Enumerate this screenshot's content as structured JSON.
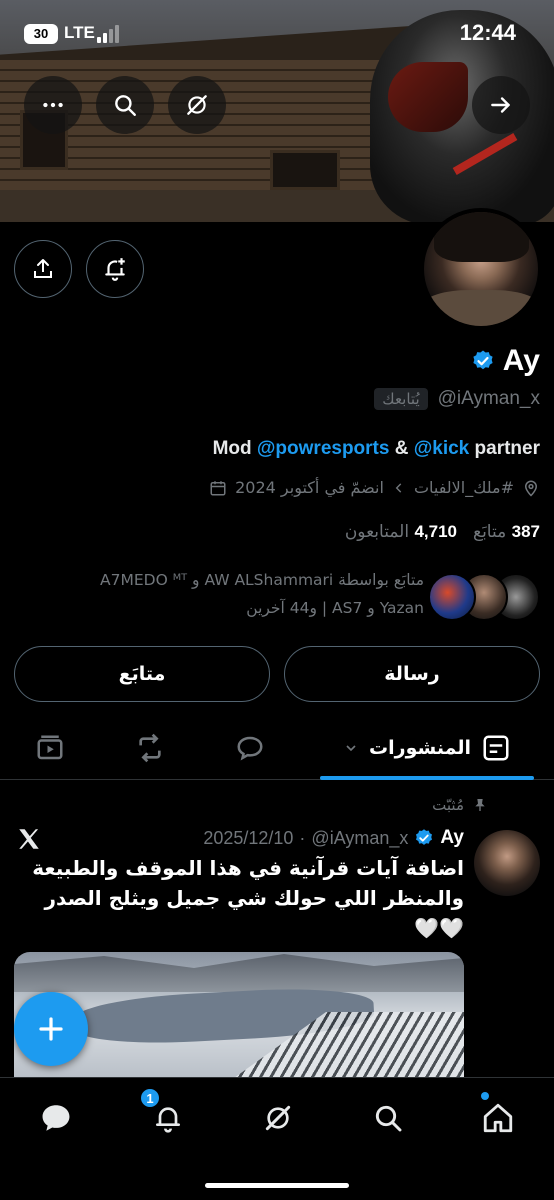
{
  "status_bar": {
    "battery": "30",
    "network": "LTE",
    "time": "12:44"
  },
  "profile": {
    "name": "Ay",
    "handle": "@iAyman_x",
    "follows_you": "يُتابعك",
    "bio_prefix": "Mod ",
    "bio_mention1": "@powresports",
    "bio_mid": " & ",
    "bio_mention2": "@kick",
    "bio_suffix": " partner",
    "location": "#ملك_الالفيات",
    "joined": "انضمّ في أكتوبر 2024",
    "following_count": "387",
    "following_label": "متابَع",
    "followers_count": "4,710",
    "followers_label": "المتابعون",
    "followed_by_line1": "متابَع بواسطة AW ALShammari و A7MEDO ᴹᵀ",
    "followed_by_line2": "Yazan و AS7 | و44 آخرين"
  },
  "actions": {
    "message": "رسالة",
    "following": "متابَع"
  },
  "tabs": {
    "posts": "المنشورات"
  },
  "post": {
    "pinned_label": "مُثبّت",
    "author_name": "Ay",
    "author_handle": "@iAyman_x",
    "separator": "·",
    "date": "2025/12/10",
    "text": "اضافة آيات قرآنية في هذا الموقف والطبيعة والمنظر اللي حولك شي جميل ويثلج الصدر 🤍🤍"
  },
  "nav": {
    "notifications_badge": "1"
  },
  "colors": {
    "accent": "#1d9bf0",
    "background": "#000000",
    "muted": "#71767b"
  }
}
